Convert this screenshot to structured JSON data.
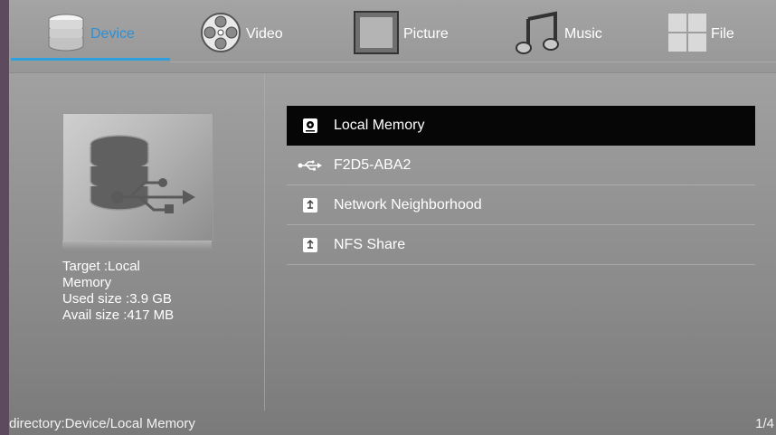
{
  "tabs": [
    {
      "label": "Device",
      "icon": "database-icon",
      "active": true
    },
    {
      "label": "Video",
      "icon": "film-reel-icon",
      "active": false
    },
    {
      "label": "Picture",
      "icon": "picture-frame-icon",
      "active": false
    },
    {
      "label": "Music",
      "icon": "music-note-icon",
      "active": false
    },
    {
      "label": "File",
      "icon": "grid-icon",
      "active": false
    }
  ],
  "preview": {
    "icon": "database-usb-icon",
    "target_line1": "Target :Local",
    "target_line2": "Memory",
    "used": "Used size :3.9 GB",
    "avail": "Avail size :417 MB"
  },
  "devices": [
    {
      "label": "Local Memory",
      "icon": "disk-icon",
      "selected": true
    },
    {
      "label": "F2D5-ABA2",
      "icon": "usb-icon",
      "selected": false
    },
    {
      "label": "Network Neighborhood",
      "icon": "network-share-icon",
      "selected": false
    },
    {
      "label": "NFS Share",
      "icon": "network-share-icon",
      "selected": false
    }
  ],
  "status": {
    "directory": "directory:Device/Local Memory",
    "page": "1/4"
  },
  "colors": {
    "accent": "#2ea0dd",
    "selected_row": "#060606"
  }
}
